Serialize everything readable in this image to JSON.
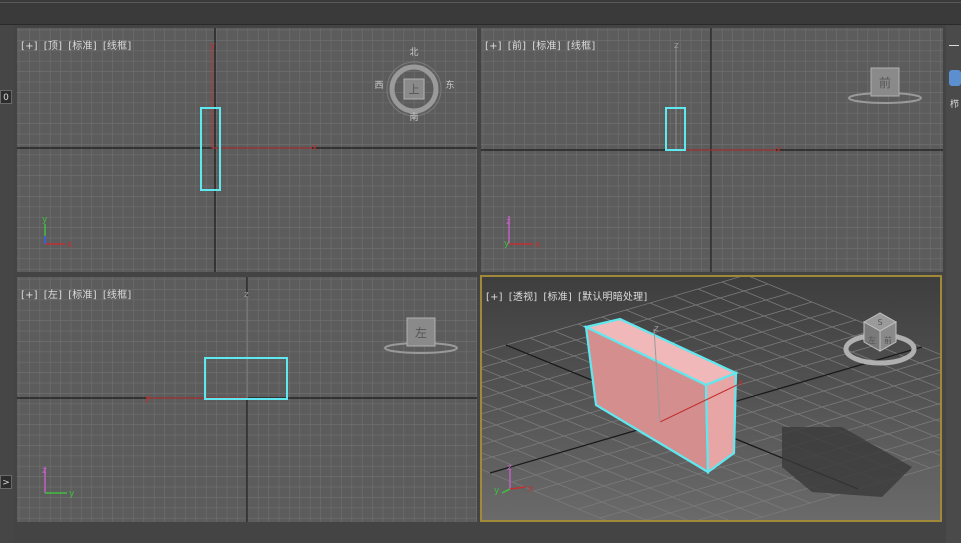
{
  "viewports": {
    "top": {
      "labels": [
        "[+]",
        "[顶]",
        "[标准]",
        "[线框]"
      ]
    },
    "front": {
      "labels": [
        "[+]",
        "[前]",
        "[标准]",
        "[线框]"
      ]
    },
    "left": {
      "labels": [
        "[+]",
        "[左]",
        "[标准]",
        "[线框]"
      ]
    },
    "perspective": {
      "labels": [
        "[+]",
        "[透视]",
        "[标准]",
        "[默认明暗处理]"
      ]
    }
  },
  "viewcube": {
    "top_face": "上",
    "compass": {
      "n": "北",
      "s": "南",
      "e": "东",
      "w": "西"
    },
    "front_face": "前",
    "left_face": "左",
    "persp_faces": {
      "top": "S",
      "left": "左",
      "front": "前"
    }
  },
  "axes": {
    "x": "x",
    "y": "y",
    "z": "z"
  },
  "colors": {
    "grid": "#6e6e6e",
    "selection": "#5fe8f0",
    "box_fill": "#e39f9f",
    "active_border": "#a08a3a"
  },
  "left_strip": {
    "btn1": "0",
    "btn2": ">"
  },
  "right_panel": {
    "label": "栉"
  }
}
